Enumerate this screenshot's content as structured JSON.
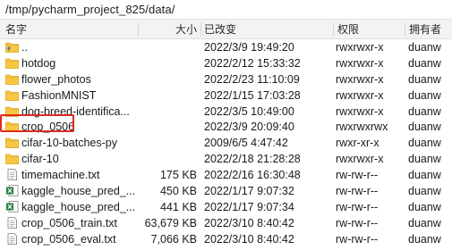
{
  "path": "/tmp/pycharm_project_825/data/",
  "columns": {
    "name": "名字",
    "size": "大小",
    "modified": "已改变",
    "permissions": "权限",
    "owner": "拥有者"
  },
  "colors": {
    "folder": "#f6c842",
    "folder_dark": "#e0a92a",
    "excel": "#1f7a3d",
    "highlight": "#e0291f"
  },
  "files": [
    {
      "icon": "parent-folder-icon",
      "name": "..",
      "size": "",
      "modified": "2022/3/9 19:49:20",
      "permissions": "rwxrwxr-x",
      "owner": "duanw"
    },
    {
      "icon": "folder-icon",
      "name": "hotdog",
      "size": "",
      "modified": "2022/2/12 15:33:32",
      "permissions": "rwxrwxr-x",
      "owner": "duanw"
    },
    {
      "icon": "folder-icon",
      "name": "flower_photos",
      "size": "",
      "modified": "2022/2/23 11:10:09",
      "permissions": "rwxrwxr-x",
      "owner": "duanw"
    },
    {
      "icon": "folder-icon",
      "name": "FashionMNIST",
      "size": "",
      "modified": "2022/1/15 17:03:28",
      "permissions": "rwxrwxr-x",
      "owner": "duanw"
    },
    {
      "icon": "folder-icon",
      "name": "dog-breed-identifica...",
      "size": "",
      "modified": "2022/3/5 10:49:00",
      "permissions": "rwxrwxr-x",
      "owner": "duanw"
    },
    {
      "icon": "folder-icon",
      "name": "crop_0506",
      "size": "",
      "modified": "2022/3/9 20:09:40",
      "permissions": "rwxrwxrwx",
      "owner": "duanw"
    },
    {
      "icon": "folder-icon",
      "name": "cifar-10-batches-py",
      "size": "",
      "modified": "2009/6/5 4:47:42",
      "permissions": "rwxr-xr-x",
      "owner": "duanw"
    },
    {
      "icon": "folder-icon",
      "name": "cifar-10",
      "size": "",
      "modified": "2022/2/18 21:28:28",
      "permissions": "rwxrwxr-x",
      "owner": "duanw"
    },
    {
      "icon": "text-file-icon",
      "name": "timemachine.txt",
      "size": "175 KB",
      "modified": "2022/2/16 16:30:48",
      "permissions": "rw-rw-r--",
      "owner": "duanw"
    },
    {
      "icon": "excel-file-icon",
      "name": "kaggle_house_pred_...",
      "size": "450 KB",
      "modified": "2022/1/17 9:07:32",
      "permissions": "rw-rw-r--",
      "owner": "duanw"
    },
    {
      "icon": "excel-file-icon",
      "name": "kaggle_house_pred_...",
      "size": "441 KB",
      "modified": "2022/1/17 9:07:34",
      "permissions": "rw-rw-r--",
      "owner": "duanw"
    },
    {
      "icon": "text-file-icon",
      "name": "crop_0506_train.txt",
      "size": "63,679 KB",
      "modified": "2022/3/10 8:40:42",
      "permissions": "rw-rw-r--",
      "owner": "duanw"
    },
    {
      "icon": "text-file-icon",
      "name": "crop_0506_eval.txt",
      "size": "7,066 KB",
      "modified": "2022/3/10 8:40:42",
      "permissions": "rw-rw-r--",
      "owner": "duanw"
    }
  ]
}
